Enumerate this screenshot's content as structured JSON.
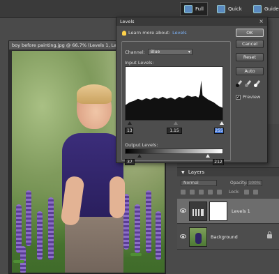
{
  "modes": {
    "full": "Full",
    "quick": "Quick",
    "guided": "Guided"
  },
  "document": {
    "tab_title": "boy before painting.jpg @ 66.7% (Levels 1, Layer M"
  },
  "levels_dialog": {
    "title": "Levels",
    "learn_prefix": "Learn more about:",
    "learn_link": "Levels",
    "ok_label": "OK",
    "cancel_label": "Cancel",
    "reset_label": "Reset",
    "auto_label": "Auto",
    "preview_label": "Preview",
    "preview_checked": true,
    "channel_label": "Channel:",
    "channel_value": "Blue",
    "input_levels_label": "Input Levels:",
    "input_black": "13",
    "input_gamma": "1.15",
    "input_white": "255",
    "output_levels_label": "Output Levels:",
    "output_black": "37",
    "output_white": "212"
  },
  "layers_panel": {
    "title": "Layers",
    "blend_mode": "Normal",
    "opacity_label": "Opacity:",
    "opacity_value": "100%",
    "lock_label": "Lock:",
    "layers": [
      {
        "name": "Levels 1"
      },
      {
        "name": "Background"
      }
    ]
  },
  "colors": {
    "dialog_bg": "#4d4d4d",
    "link": "#7fb6ff",
    "input_white_highlight": "#3b6fd1"
  }
}
